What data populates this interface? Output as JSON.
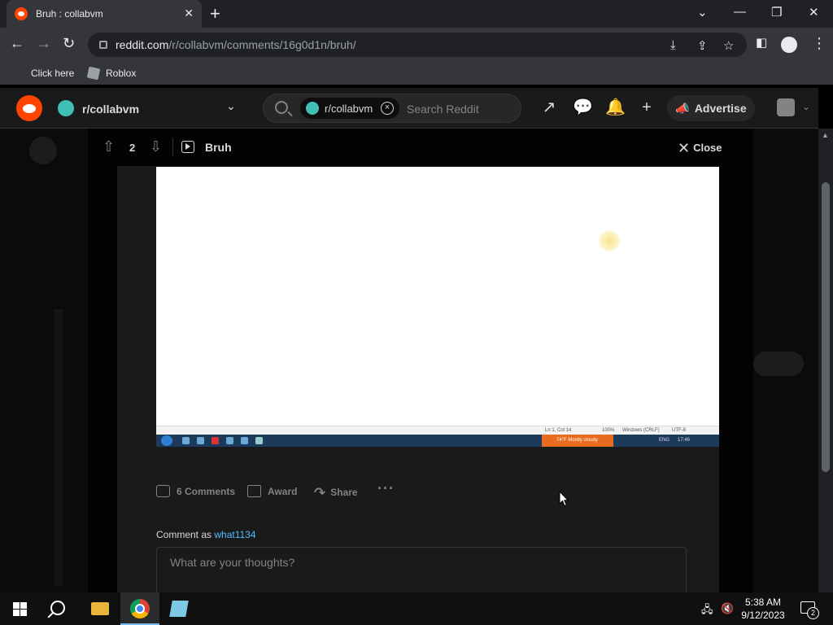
{
  "browser": {
    "tab_title": "Bruh : collabvm",
    "url_host": "reddit.com",
    "url_path": "/r/collabvm/comments/16g0d1n/bruh/",
    "bookmarks": [
      "Click here",
      "Roblox"
    ]
  },
  "reddit_header": {
    "subreddit": "r/collabvm",
    "search_chip": "r/collabvm",
    "search_placeholder": "Search Reddit",
    "advertise_label": "Advertise"
  },
  "post": {
    "vote_count": "2",
    "title": "Bruh",
    "close_label": "Close",
    "video_status": {
      "position": "Ln 1, Col 14",
      "zoom": "100%",
      "line_endings": "Windows (CRLF)",
      "encoding": "UTF-8",
      "weather": "74°F  Mostly cloudy",
      "lang": "ENG",
      "time": "17:46"
    },
    "actions": {
      "comments": "6 Comments",
      "award": "Award",
      "share": "Share",
      "more": "···"
    },
    "comment_as_prefix": "Comment as",
    "comment_user": "what1134",
    "comment_placeholder": "What are your thoughts?"
  },
  "taskbar": {
    "time": "5:38 AM",
    "date": "9/12/2023",
    "notification_count": "2"
  },
  "colors": {
    "reddit_orange": "#ff4500",
    "link_blue": "#4fbcff",
    "weather_orange": "#e86b1f"
  }
}
